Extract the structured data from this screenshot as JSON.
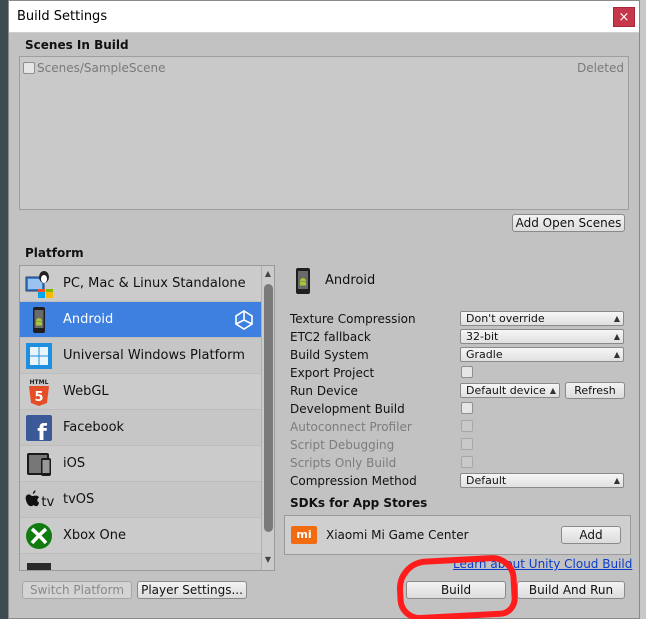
{
  "window": {
    "title": "Build Settings",
    "close_glyph": "×"
  },
  "scenes": {
    "heading": "Scenes In Build",
    "items": [
      {
        "name": "Scenes/SampleScene",
        "status": "Deleted"
      }
    ],
    "add_open_scenes": "Add Open Scenes"
  },
  "platform": {
    "heading": "Platform",
    "items": [
      {
        "label": "PC, Mac & Linux Standalone",
        "icon": "pc-standalone-icon"
      },
      {
        "label": "Android",
        "icon": "android-icon",
        "selected": true
      },
      {
        "label": "Universal Windows Platform",
        "icon": "windows-icon"
      },
      {
        "label": "WebGL",
        "icon": "html5-icon"
      },
      {
        "label": "Facebook",
        "icon": "facebook-icon"
      },
      {
        "label": "iOS",
        "icon": "ios-icon"
      },
      {
        "label": "tvOS",
        "icon": "tvos-icon"
      },
      {
        "label": "Xbox One",
        "icon": "xbox-icon"
      }
    ],
    "tvos_text": "tv",
    "html5_text": "HTML",
    "html5_num": "5",
    "facebook_glyph": "f"
  },
  "settings": {
    "platform_title": "Android",
    "texture_compression": {
      "label": "Texture Compression",
      "value": "Don't override"
    },
    "etc2_fallback": {
      "label": "ETC2 fallback",
      "value": "32-bit"
    },
    "build_system": {
      "label": "Build System",
      "value": "Gradle"
    },
    "export_project": {
      "label": "Export Project"
    },
    "run_device": {
      "label": "Run Device",
      "value": "Default device",
      "refresh": "Refresh"
    },
    "development_build": {
      "label": "Development Build"
    },
    "autoconnect_profiler": {
      "label": "Autoconnect Profiler"
    },
    "script_debugging": {
      "label": "Script Debugging"
    },
    "scripts_only_build": {
      "label": "Scripts Only Build"
    },
    "compression_method": {
      "label": "Compression Method",
      "value": "Default"
    }
  },
  "sdks": {
    "heading": "SDKs for App Stores",
    "items": [
      {
        "name": "Xiaomi Mi Game Center",
        "logo_text": "mi",
        "button": "Add"
      }
    ]
  },
  "footer": {
    "cloud_link": "Learn about Unity Cloud Build",
    "switch_platform": "Switch Platform",
    "player_settings": "Player Settings...",
    "build": "Build",
    "build_and_run": "Build And Run"
  },
  "colors": {
    "selection": "#3d80df",
    "window_bg": "#c2c2c2",
    "annotation": "#ff1c1c",
    "xiaomi_orange": "#f36b10"
  }
}
